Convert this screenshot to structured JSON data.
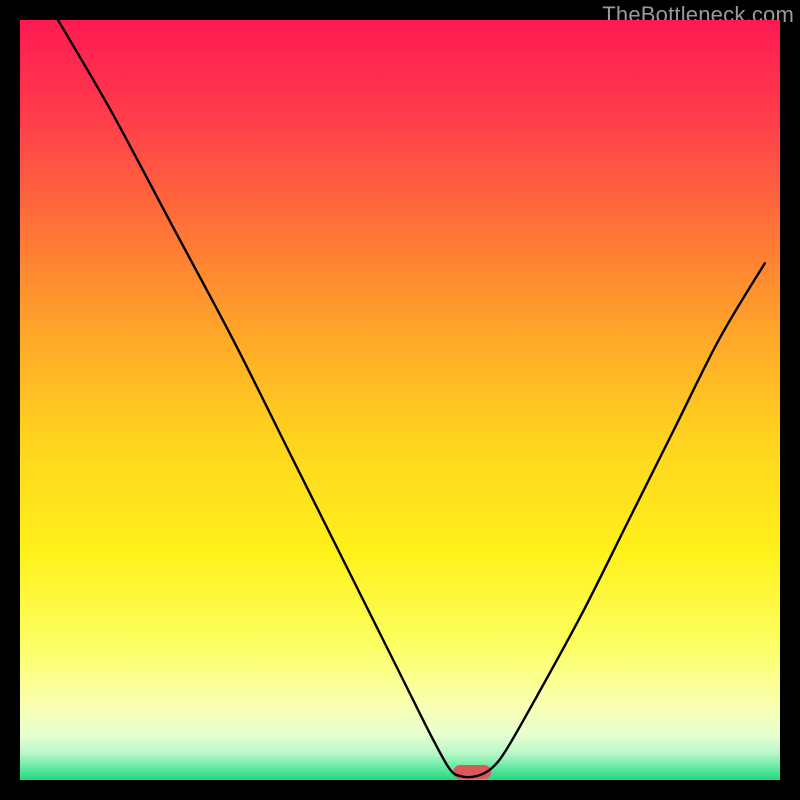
{
  "watermark": "TheBottleneck.com",
  "chart_data": {
    "type": "line",
    "title": "",
    "xlabel": "",
    "ylabel": "",
    "xlim": [
      0,
      100
    ],
    "ylim": [
      0,
      100
    ],
    "grid": false,
    "legend": false,
    "series": [
      {
        "name": "curve",
        "x": [
          5,
          12,
          20,
          28,
          36,
          44,
          50,
          54,
          56.5,
          58,
          60,
          62,
          64,
          68,
          74,
          80,
          86,
          92,
          98
        ],
        "y": [
          100,
          88,
          73,
          58,
          42,
          26,
          14,
          6,
          1.5,
          0.5,
          0.5,
          1.5,
          4,
          11,
          22,
          34,
          46,
          58,
          68
        ]
      }
    ],
    "marker": {
      "x_center": 59.5,
      "width_pct": 5,
      "color": "#d85a5a"
    },
    "gradient_bands": [
      {
        "stop": 0.0,
        "color": "#ff1a52"
      },
      {
        "stop": 0.12,
        "color": "#ff3a4c"
      },
      {
        "stop": 0.25,
        "color": "#ff6a3a"
      },
      {
        "stop": 0.4,
        "color": "#ffa22a"
      },
      {
        "stop": 0.55,
        "color": "#ffd31f"
      },
      {
        "stop": 0.7,
        "color": "#fff11a"
      },
      {
        "stop": 0.82,
        "color": "#fcff60"
      },
      {
        "stop": 0.9,
        "color": "#faffb0"
      },
      {
        "stop": 0.94,
        "color": "#e8ffd0"
      },
      {
        "stop": 0.965,
        "color": "#b8f8c8"
      },
      {
        "stop": 0.985,
        "color": "#5ee8a0"
      },
      {
        "stop": 1.0,
        "color": "#1fd880"
      }
    ]
  }
}
